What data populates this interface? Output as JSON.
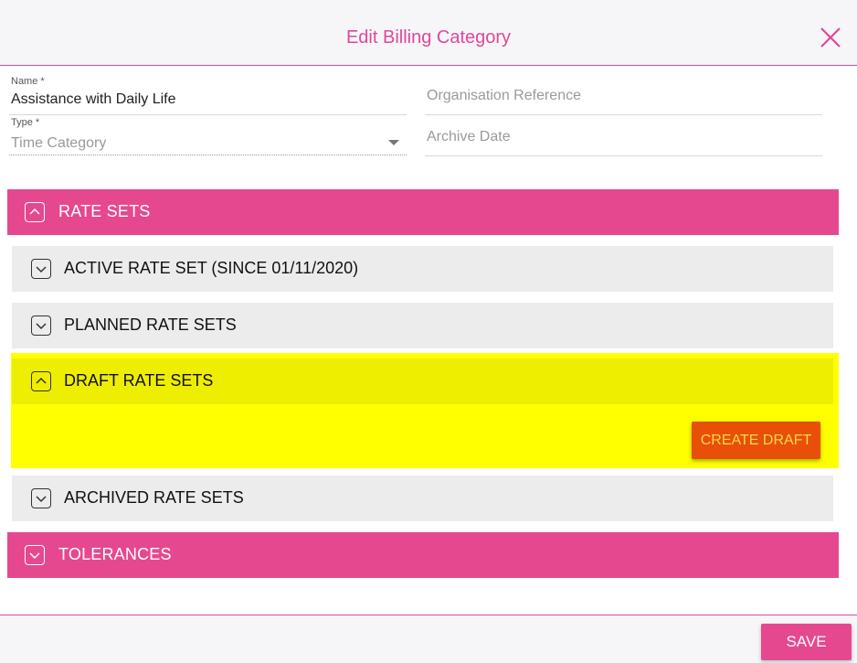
{
  "dialog": {
    "title": "Edit Billing Category",
    "close_icon": "close-icon"
  },
  "form": {
    "name": {
      "label": "Name *",
      "value": "Assistance with Daily Life"
    },
    "organisation_reference": {
      "placeholder": "Organisation Reference"
    },
    "type": {
      "label": "Type *",
      "value": "Time Category"
    },
    "archive_date": {
      "placeholder": "Archive Date"
    }
  },
  "sections": {
    "rate_sets": {
      "label": "RATE SETS",
      "expanded": true,
      "subsections": {
        "active": {
          "label": "ACTIVE RATE SET (SINCE 01/11/2020)",
          "expanded": false
        },
        "planned": {
          "label": "PLANNED RATE SETS",
          "expanded": false
        },
        "draft": {
          "label": "DRAFT RATE SETS",
          "expanded": true,
          "create_label": "CREATE DRAFT"
        },
        "archived": {
          "label": "ARCHIVED RATE SETS",
          "expanded": false
        }
      }
    },
    "tolerances": {
      "label": "TOLERANCES",
      "expanded": false
    }
  },
  "footer": {
    "save_label": "SAVE"
  },
  "colors": {
    "accent": "#e6488f",
    "highlight": "#ffff00",
    "create_button": "#e8500a"
  }
}
